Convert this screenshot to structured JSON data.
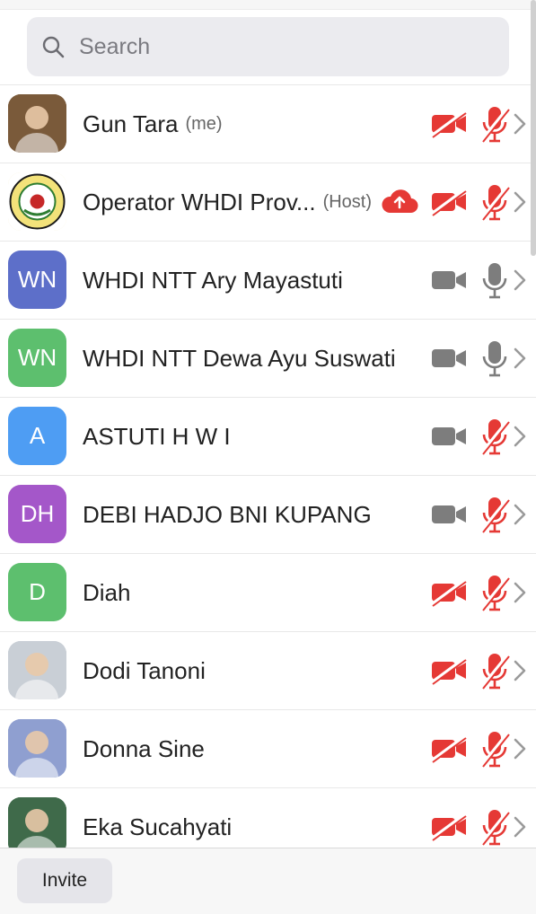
{
  "search": {
    "placeholder": "Search"
  },
  "participants": [
    {
      "name": "Gun Tara",
      "tag": "(me)",
      "avatar_text": "",
      "avatar_color": "#7a5a3a",
      "photo": true,
      "cloud": false,
      "video": "off",
      "audio": "muted"
    },
    {
      "name": "Operator WHDI Prov...",
      "tag": "(Host)",
      "avatar_text": "",
      "avatar_color": "#f1e7b0",
      "photo": true,
      "cloud": true,
      "video": "off",
      "audio": "muted"
    },
    {
      "name": "WHDI NTT Ary Mayastuti",
      "tag": "",
      "avatar_text": "WN",
      "avatar_color": "#5d6fc9",
      "photo": false,
      "cloud": false,
      "video": "on",
      "audio": "on"
    },
    {
      "name": "WHDI NTT Dewa Ayu Suswati",
      "tag": "",
      "avatar_text": "WN",
      "avatar_color": "#5dbf6e",
      "photo": false,
      "cloud": false,
      "video": "on",
      "audio": "on"
    },
    {
      "name": "ASTUTI  H W I",
      "tag": "",
      "avatar_text": "A",
      "avatar_color": "#4e9df3",
      "photo": false,
      "cloud": false,
      "video": "on",
      "audio": "muted"
    },
    {
      "name": "DEBI HADJO BNI KUPANG",
      "tag": "",
      "avatar_text": "DH",
      "avatar_color": "#a457c9",
      "photo": false,
      "cloud": false,
      "video": "on",
      "audio": "muted"
    },
    {
      "name": "Diah",
      "tag": "",
      "avatar_text": "D",
      "avatar_color": "#5dbf6e",
      "photo": false,
      "cloud": false,
      "video": "off",
      "audio": "muted"
    },
    {
      "name": "Dodi Tanoni",
      "tag": "",
      "avatar_text": "",
      "avatar_color": "#c9cfd6",
      "photo": true,
      "cloud": false,
      "video": "off",
      "audio": "muted"
    },
    {
      "name": "Donna Sine",
      "tag": "",
      "avatar_text": "",
      "avatar_color": "#8f9fd0",
      "photo": true,
      "cloud": false,
      "video": "off",
      "audio": "muted"
    },
    {
      "name": "Eka Sucahyati",
      "tag": "",
      "avatar_text": "",
      "avatar_color": "#3f6a4a",
      "photo": true,
      "cloud": false,
      "video": "off",
      "audio": "muted"
    }
  ],
  "footer": {
    "invite_label": "Invite"
  },
  "colors": {
    "muted_red": "#e53935",
    "icon_gray": "#7d7d7d",
    "divider": "#e8e8e8"
  }
}
